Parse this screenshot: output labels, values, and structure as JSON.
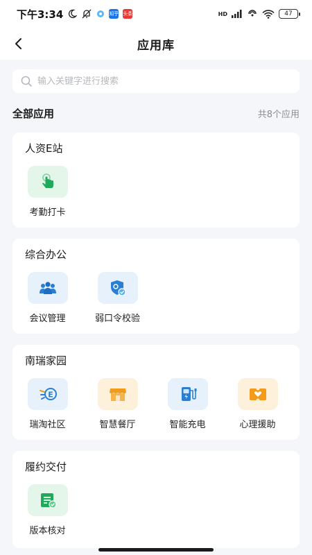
{
  "status_bar": {
    "time": "下午3:34",
    "mini_icons": [
      {
        "name": "zhihu-notification-icon",
        "text": "知乎",
        "color": "#1a73e8"
      },
      {
        "name": "toutiao-notification-icon",
        "text": "头条",
        "color": "#e53935"
      }
    ],
    "network_label": "HD",
    "battery": "47"
  },
  "nav": {
    "title": "应用库"
  },
  "search": {
    "placeholder": "输入关键字进行搜索"
  },
  "all_apps": {
    "title": "全部应用",
    "count": "共8个应用"
  },
  "categories": [
    {
      "title": "人资E站",
      "apps": [
        {
          "label": "考勤打卡",
          "icon": "tap-finger-icon",
          "bg": "#e3f6e9",
          "fg": "#1faa5b"
        }
      ]
    },
    {
      "title": "综合办公",
      "apps": [
        {
          "label": "会议管理",
          "icon": "meeting-people-icon",
          "bg": "#e6f1fb",
          "fg": "#2a7fd4"
        },
        {
          "label": "弱口令校验",
          "icon": "shield-check-icon",
          "bg": "#e6f1fb",
          "fg": "#2a7fd4"
        }
      ]
    },
    {
      "title": "南瑞家园",
      "apps": [
        {
          "label": "瑞淘社区",
          "icon": "community-e-icon",
          "bg": "#e6f1fb",
          "fg": "#2a7fd4"
        },
        {
          "label": "智慧餐厅",
          "icon": "restaurant-icon",
          "bg": "#fdf1dc",
          "fg": "#f29b1a"
        },
        {
          "label": "智能充电",
          "icon": "charging-station-icon",
          "bg": "#e6f1fb",
          "fg": "#2a7fd4"
        },
        {
          "label": "心理援助",
          "icon": "heart-card-icon",
          "bg": "#fdf1dc",
          "fg": "#f29b1a"
        }
      ]
    },
    {
      "title": "履约交付",
      "apps": [
        {
          "label": "版本核对",
          "icon": "document-check-icon",
          "bg": "#e3f6e9",
          "fg": "#1faa5b"
        }
      ]
    }
  ]
}
